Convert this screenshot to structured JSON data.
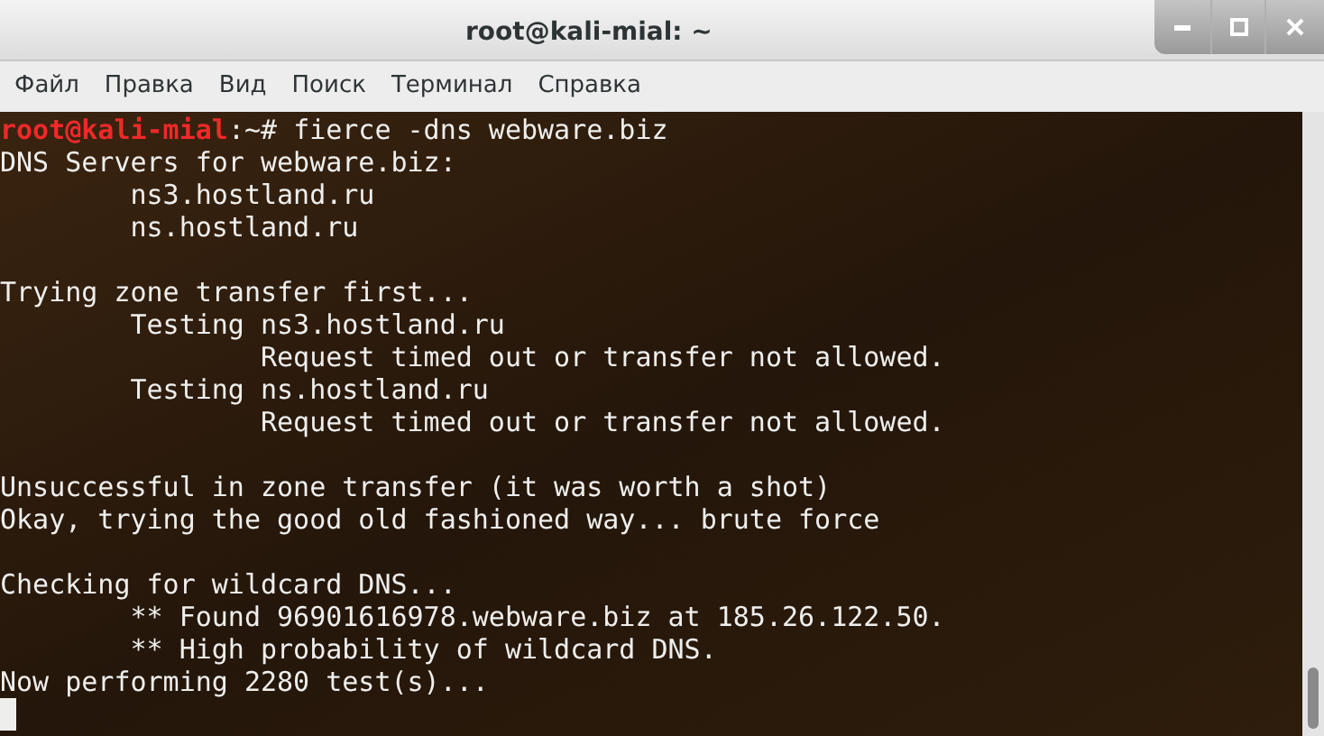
{
  "window": {
    "title": "root@kali-mial: ~"
  },
  "menu": [
    "Файл",
    "Правка",
    "Вид",
    "Поиск",
    "Терминал",
    "Справка"
  ],
  "terminal": {
    "prompt": {
      "user_host": "root@kali-mial",
      "path": ":~# ",
      "command": "fierce -dns webware.biz"
    },
    "lines": [
      {
        "kind": "text",
        "text": "DNS Servers for webware.biz:"
      },
      {
        "kind": "text",
        "text": "        ns3.hostland.ru"
      },
      {
        "kind": "text",
        "text": "        ns.hostland.ru"
      },
      {
        "kind": "blank"
      },
      {
        "kind": "text",
        "text": "Trying zone transfer first..."
      },
      {
        "kind": "text",
        "text": "        Testing ns3.hostland.ru"
      },
      {
        "kind": "text",
        "text": "                Request timed out or transfer not allowed."
      },
      {
        "kind": "text",
        "text": "        Testing ns.hostland.ru"
      },
      {
        "kind": "text",
        "text": "                Request timed out or transfer not allowed."
      },
      {
        "kind": "blank"
      },
      {
        "kind": "text",
        "text": "Unsuccessful in zone transfer (it was worth a shot)"
      },
      {
        "kind": "text",
        "text": "Okay, trying the good old fashioned way... brute force"
      },
      {
        "kind": "blank"
      },
      {
        "kind": "text",
        "text": "Checking for wildcard DNS..."
      },
      {
        "kind": "text",
        "text": "        ** Found 96901616978.webware.biz at 185.26.122.50."
      },
      {
        "kind": "text",
        "text": "        ** High probability of wildcard DNS."
      },
      {
        "kind": "text",
        "text": "Now performing 2280 test(s)..."
      }
    ]
  }
}
